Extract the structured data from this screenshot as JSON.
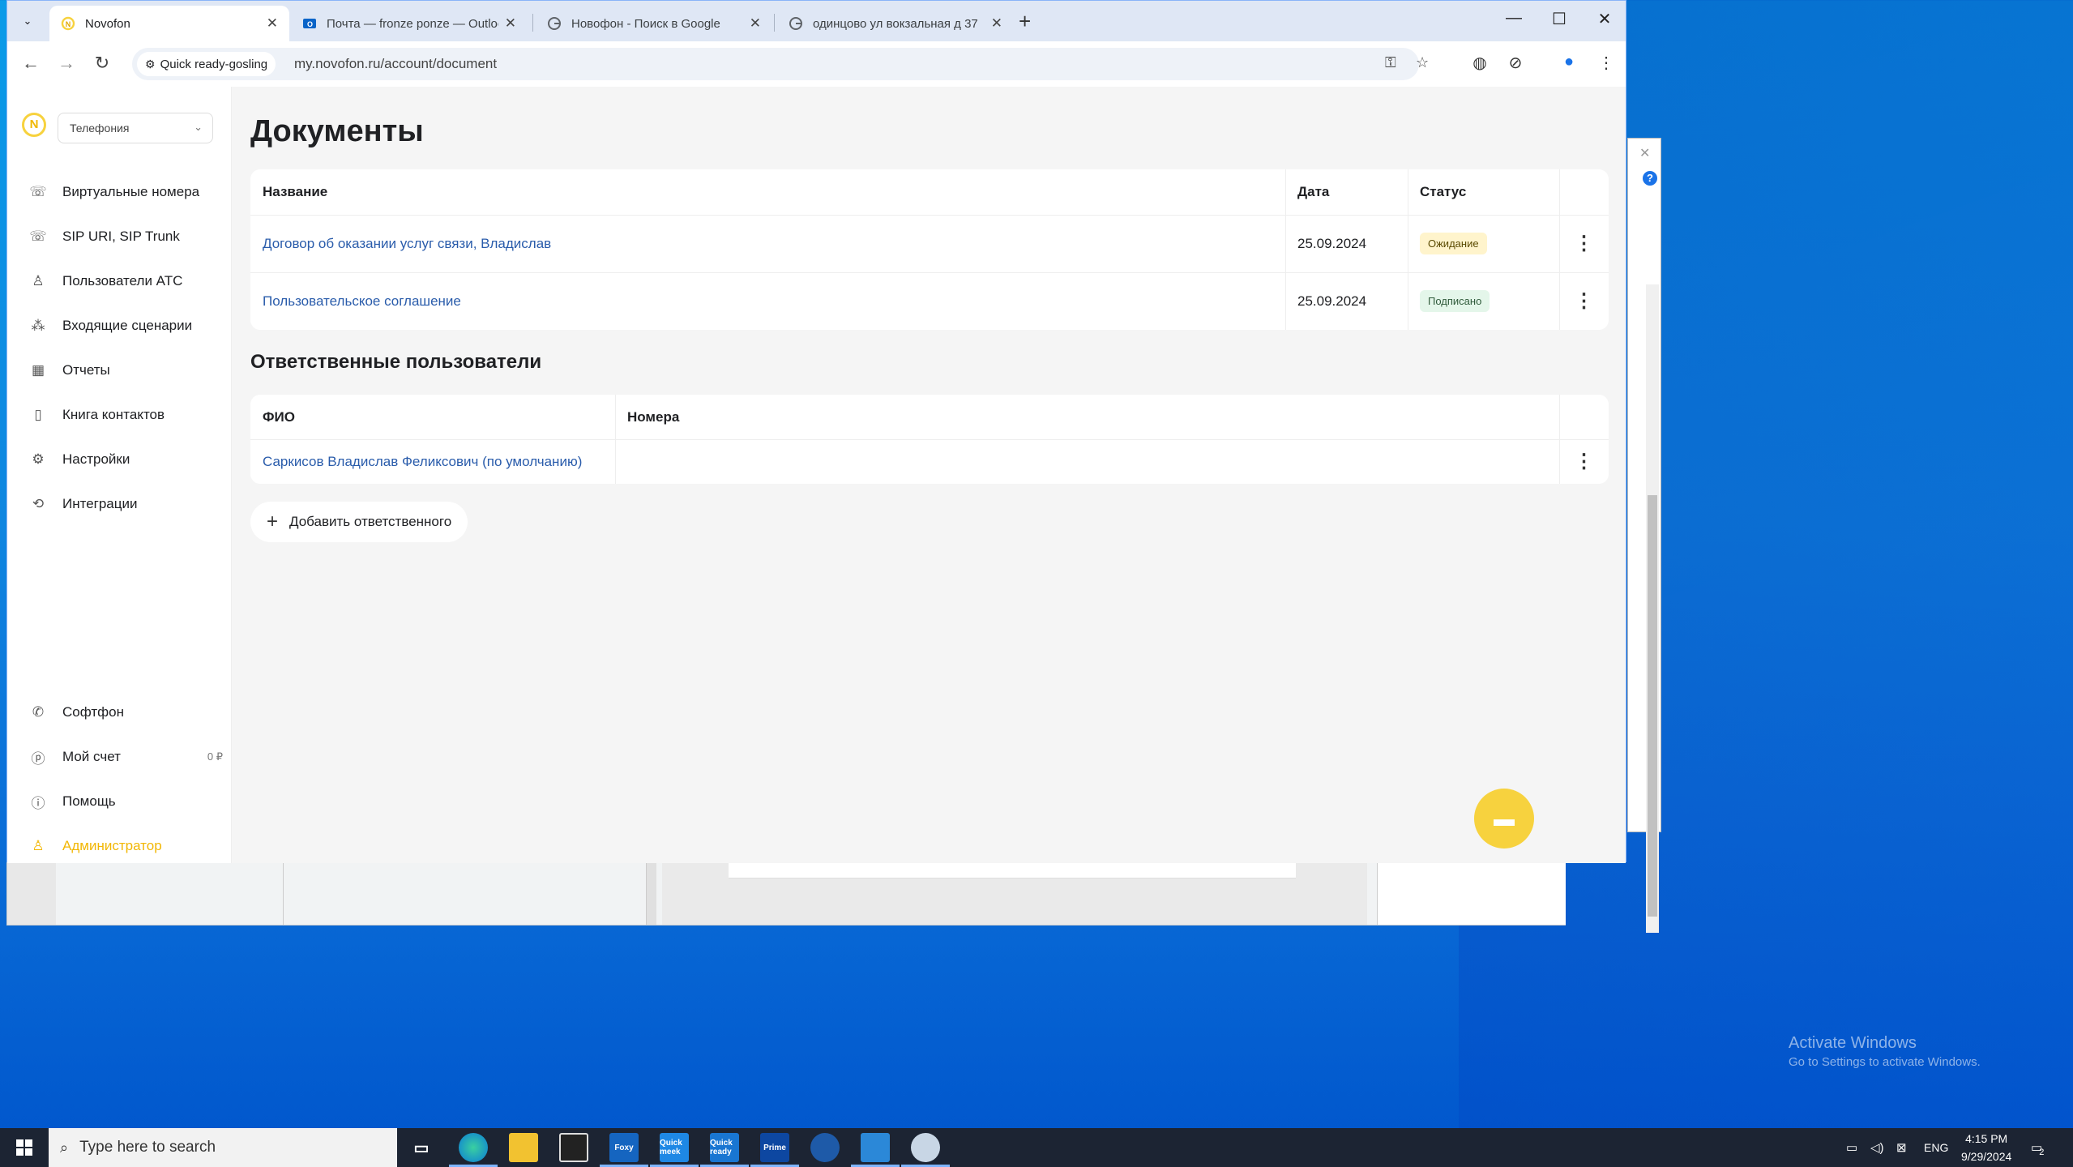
{
  "browser": {
    "tabs": [
      {
        "title": "Novofon",
        "favicon": "novofon-icon",
        "active": true
      },
      {
        "title": "Почта — fronze ponze — Outlook",
        "favicon": "outlook-icon",
        "active": false
      },
      {
        "title": "Новофон - Поиск в Google",
        "favicon": "google-icon",
        "active": false
      },
      {
        "title": "одинцово ул вокзальная д 37",
        "favicon": "google-icon",
        "active": false
      }
    ],
    "profile_chip": "Quick ready-gosling",
    "url": "my.novofon.ru/account/document"
  },
  "sidebar": {
    "product_select": "Телефония",
    "items": [
      {
        "label": "Виртуальные номера",
        "icon": "phone-forward-icon"
      },
      {
        "label": "SIP URI, SIP Trunk",
        "icon": "sip-icon"
      },
      {
        "label": "Пользователи АТС",
        "icon": "user-icon"
      },
      {
        "label": "Входящие сценарии",
        "icon": "flow-icon"
      },
      {
        "label": "Отчеты",
        "icon": "calendar-icon"
      },
      {
        "label": "Книга контактов",
        "icon": "book-icon"
      },
      {
        "label": "Настройки",
        "icon": "gear-icon"
      },
      {
        "label": "Интеграции",
        "icon": "integration-icon"
      }
    ],
    "bottom": [
      {
        "label": "Софтфон",
        "icon": "phone-icon"
      },
      {
        "label": "Мой счет",
        "icon": "ruble-icon",
        "balance": "0 ₽"
      },
      {
        "label": "Помощь",
        "icon": "info-icon"
      },
      {
        "label": "Администратор",
        "icon": "admin-user-icon"
      }
    ]
  },
  "page": {
    "title": "Документы",
    "documents": {
      "headers": {
        "name": "Название",
        "date": "Дата",
        "status": "Статус"
      },
      "rows": [
        {
          "name": "Договор об оказании услуг связи, Владислав",
          "date": "25.09.2024",
          "status": "Ожидание",
          "status_color": "#fff4cc"
        },
        {
          "name": "Пользовательское соглашение",
          "date": "25.09.2024",
          "status": "Подписано",
          "status_color": "#e4f6ea"
        }
      ]
    },
    "responsible": {
      "title": "Ответственные пользователи",
      "headers": {
        "fio": "ФИО",
        "numbers": "Номера"
      },
      "rows": [
        {
          "fio": "Саркисов Владислав Феликсович (по умолчанию)",
          "numbers": ""
        }
      ],
      "add_button": "Добавить ответственного"
    }
  },
  "desktop": {
    "watermark_title": "Activate Windows",
    "watermark_sub": "Go to Settings to activate Windows."
  },
  "taskbar": {
    "search_placeholder": "Type here to search",
    "apps": [
      {
        "name": "task-view-icon",
        "label": ""
      },
      {
        "name": "edge-icon",
        "label": ""
      },
      {
        "name": "file-explorer-icon",
        "label": ""
      },
      {
        "name": "terminal-icon",
        "label": ""
      },
      {
        "name": "app-foxy-icon",
        "label": "Foxy"
      },
      {
        "name": "app-quick-meek-icon",
        "label": "Quick meek"
      },
      {
        "name": "app-quick-ready-icon",
        "label": "Quick ready"
      },
      {
        "name": "app-prime-icon",
        "label": "Prime"
      },
      {
        "name": "app-bird-icon",
        "label": ""
      },
      {
        "name": "app-outlook-icon",
        "label": ""
      },
      {
        "name": "app-paint-icon",
        "label": ""
      }
    ],
    "lang": "ENG",
    "time": "4:15 PM",
    "date": "9/29/2024",
    "notifications": "2"
  },
  "colors": {
    "accent_yellow": "#f7d23e",
    "link_blue": "#2a5cab",
    "desktop_blue": "#0a9be8"
  }
}
